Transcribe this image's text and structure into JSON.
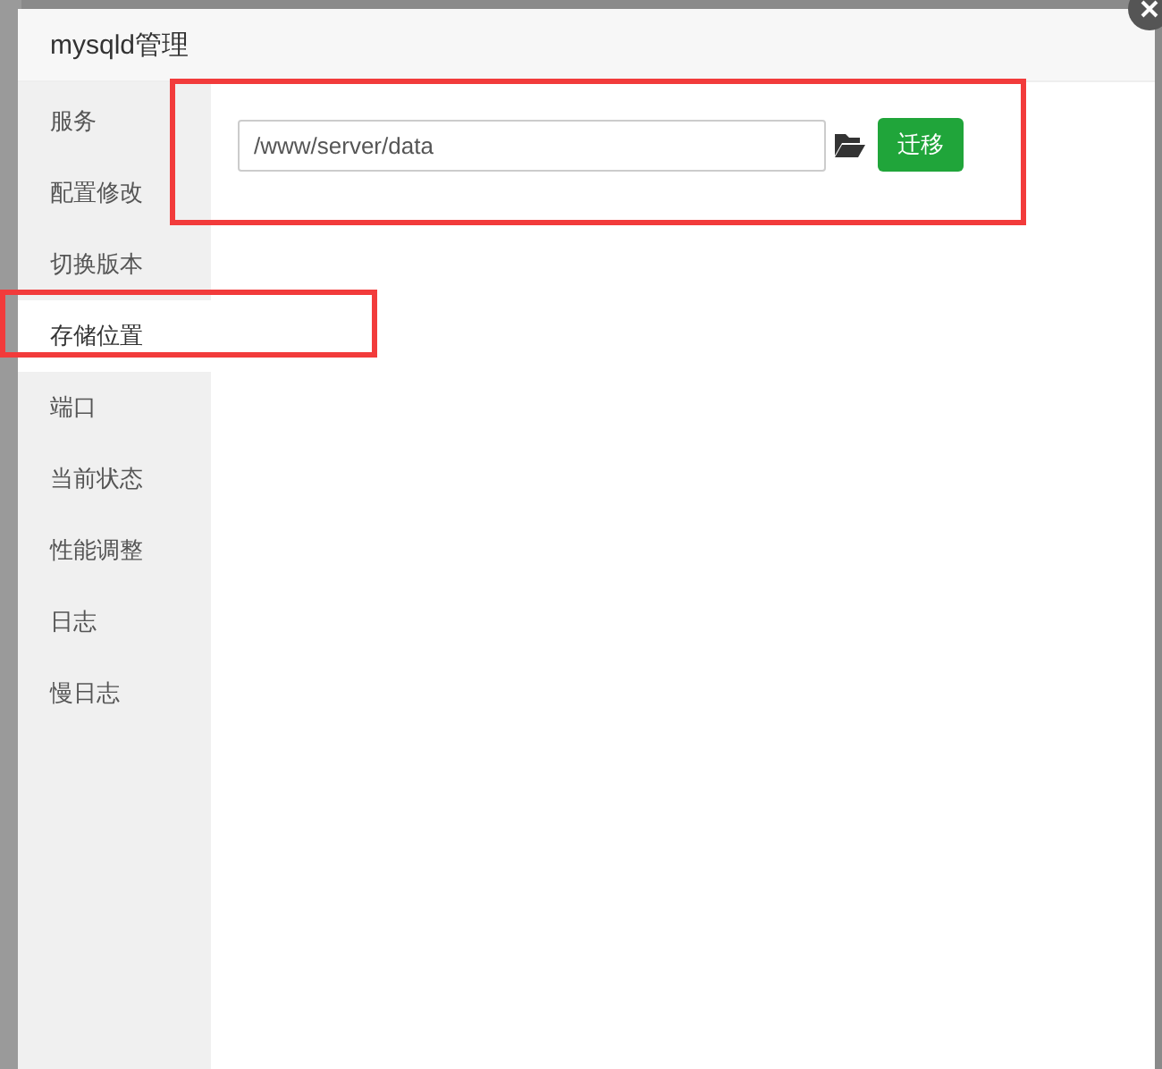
{
  "window": {
    "title": "mysqld管理"
  },
  "sidebar": {
    "items": [
      {
        "label": "服务",
        "selected": false
      },
      {
        "label": "配置修改",
        "selected": false
      },
      {
        "label": "切换版本",
        "selected": false
      },
      {
        "label": "存储位置",
        "selected": true
      },
      {
        "label": "端口",
        "selected": false
      },
      {
        "label": "当前状态",
        "selected": false
      },
      {
        "label": "性能调整",
        "selected": false
      },
      {
        "label": "日志",
        "selected": false
      },
      {
        "label": "慢日志",
        "selected": false
      }
    ]
  },
  "storage": {
    "path_field": {
      "value": "/www/server/data"
    },
    "migrate_button": "迁移"
  }
}
